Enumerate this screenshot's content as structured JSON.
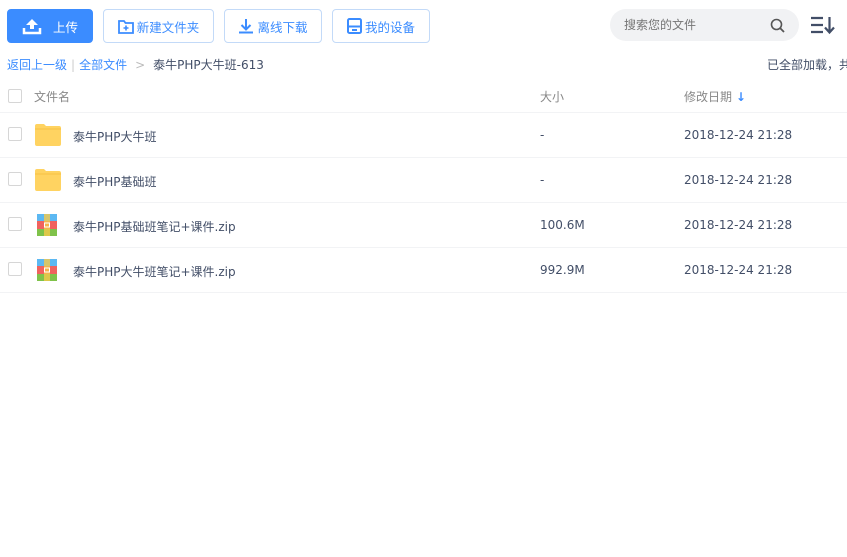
{
  "toolbar": {
    "upload": "上传",
    "new_folder": "新建文件夹",
    "offline_download": "离线下载",
    "my_devices": "我的设备"
  },
  "search": {
    "placeholder": "搜索您的文件"
  },
  "breadcrumb": {
    "back": "返回上一级",
    "all_files": "全部文件",
    "separator": ">",
    "current": "泰牛PHP大牛班-613"
  },
  "status": "已全部加载，共",
  "columns": {
    "name": "文件名",
    "size": "大小",
    "date": "修改日期",
    "sort_icon": "arrow-down"
  },
  "accent": "#3b8cff",
  "files": [
    {
      "name": "泰牛PHP大牛班",
      "size": "-",
      "date": "2018-12-24 21:28",
      "type": "folder"
    },
    {
      "name": "泰牛PHP基础班",
      "size": "-",
      "date": "2018-12-24 21:28",
      "type": "folder"
    },
    {
      "name": "泰牛PHP基础班笔记+课件.zip",
      "size": "100.6M",
      "date": "2018-12-24 21:28",
      "type": "zip"
    },
    {
      "name": "泰牛PHP大牛班笔记+课件.zip",
      "size": "992.9M",
      "date": "2018-12-24 21:28",
      "type": "zip"
    }
  ]
}
